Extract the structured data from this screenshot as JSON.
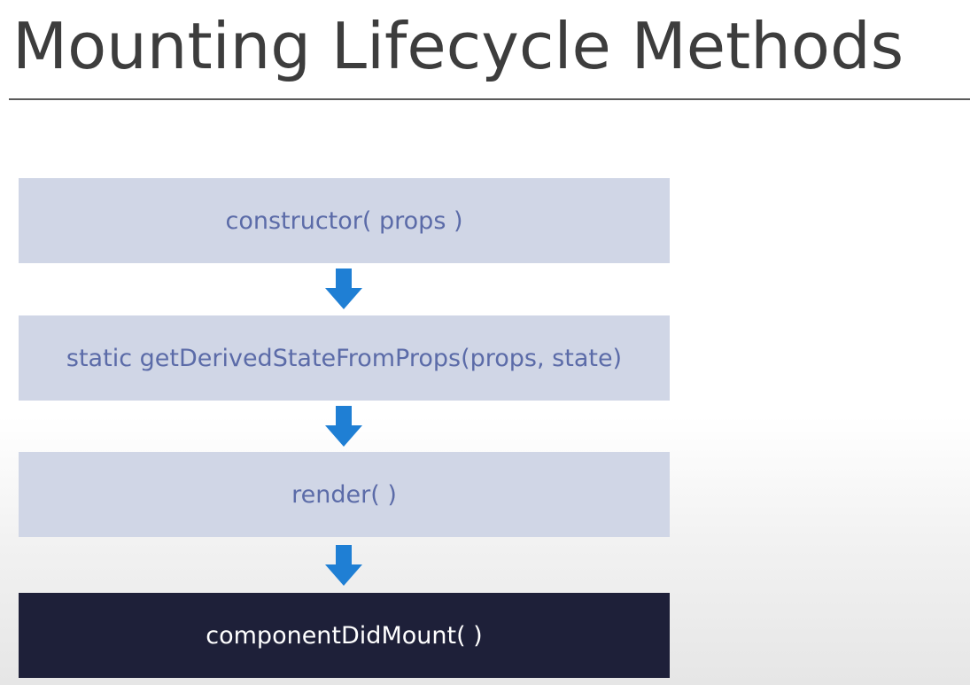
{
  "slide": {
    "title": "Mounting Lifecycle Methods"
  },
  "steps": [
    {
      "label": "constructor( props )"
    },
    {
      "label": "static getDerivedStateFromProps(props, state)"
    },
    {
      "label": "render( )"
    },
    {
      "label": "componentDidMount( )"
    }
  ],
  "colors": {
    "step_fill": "#d0d6e6",
    "step_text": "#5b6ba8",
    "active_fill": "#1e2039",
    "active_text": "#ffffff",
    "arrow": "#1f7fd4",
    "title_text": "#3d3d3d"
  },
  "icons": {
    "connector": "down-arrow-icon"
  }
}
